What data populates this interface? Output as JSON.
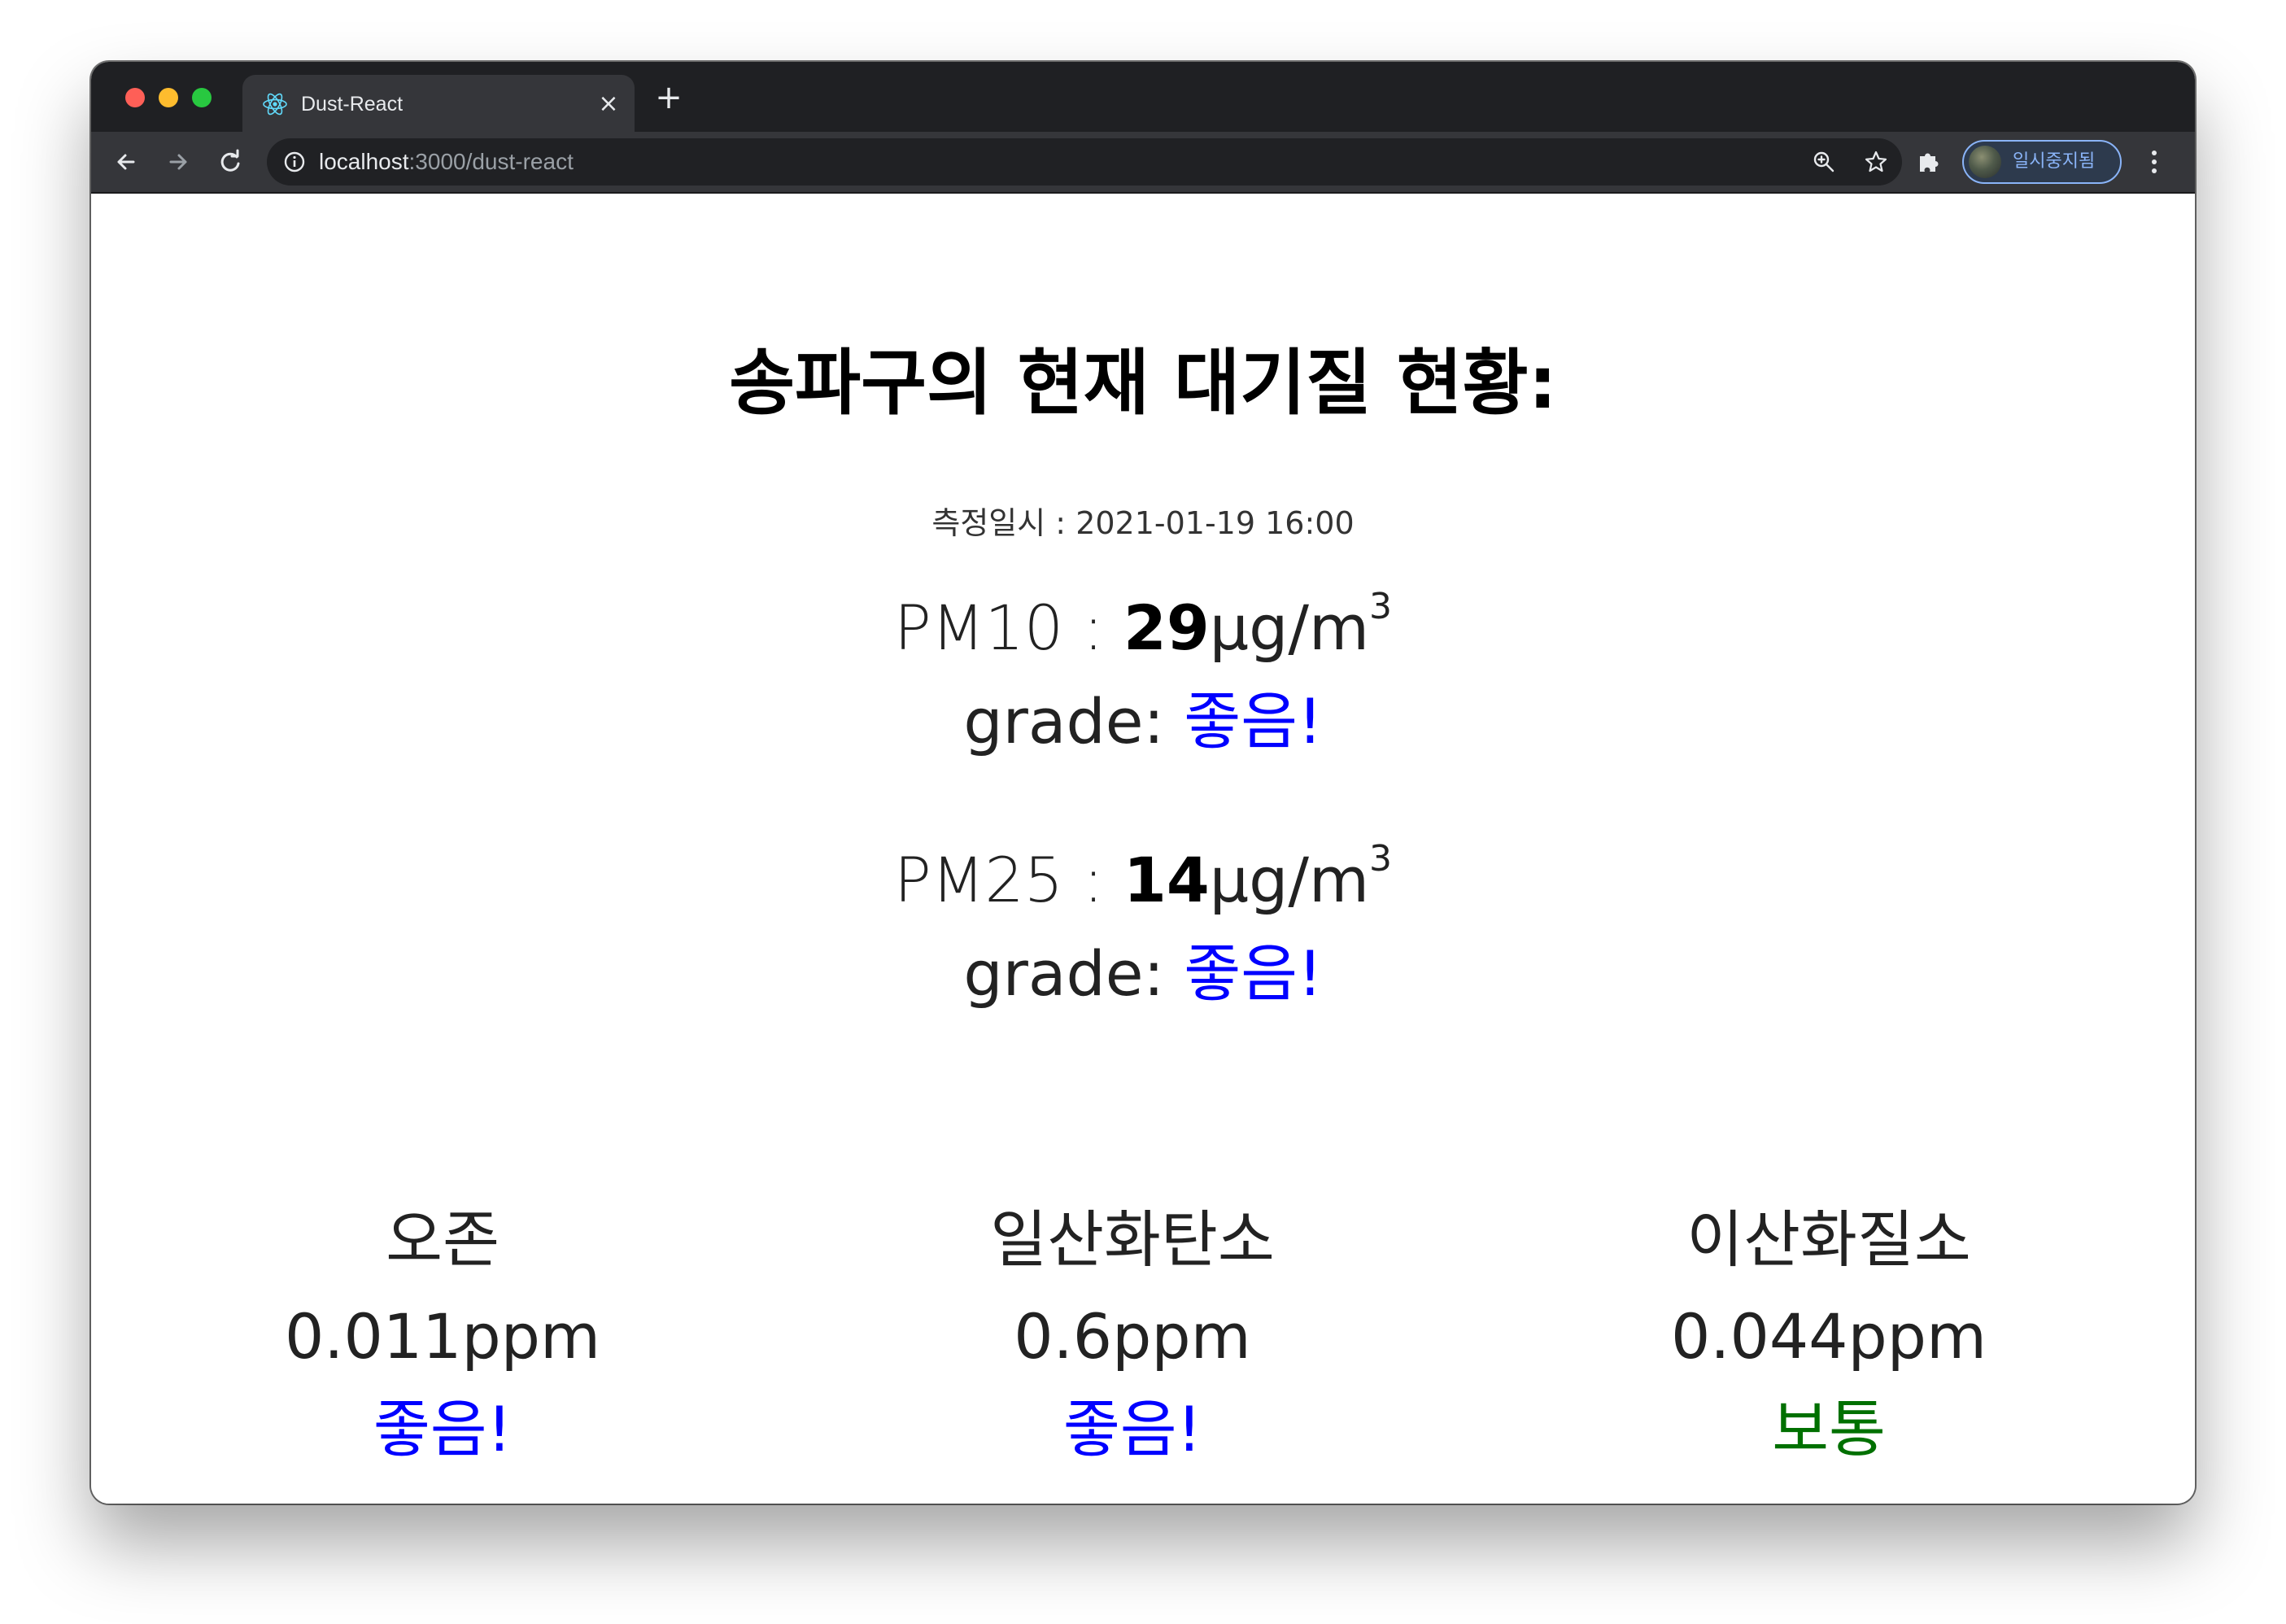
{
  "browser": {
    "tab_title": "Dust-React",
    "tab_close": "×",
    "new_tab": "+",
    "url_host": "localhost",
    "url_rest": ":3000/dust-react",
    "profile_label": "일시중지됨"
  },
  "page": {
    "title": "송파구의 현재 대기질 현황:",
    "measured_label": "측정일시 :",
    "measured_time": "2021-01-19 16:00",
    "pm10": {
      "label": "PM10",
      "separator": " : ",
      "value": "29",
      "unit": "μg/m",
      "unit_exp": "3",
      "grade_label": "grade: ",
      "grade": "좋음!"
    },
    "pm25": {
      "label": "PM25",
      "separator": " : ",
      "value": "14",
      "unit": "μg/m",
      "unit_exp": "3",
      "grade_label": "grade: ",
      "grade": "좋음!"
    },
    "gases": [
      {
        "name": "오존",
        "value": "0.011ppm",
        "grade": "좋음!"
      },
      {
        "name": "일산화탄소",
        "value": "0.6ppm",
        "grade": "좋음!"
      },
      {
        "name": "이산화질소",
        "value": "0.044ppm",
        "grade": "보통"
      }
    ]
  },
  "colors": {
    "grade_good": "#0000ff",
    "grade_normal": "#007000",
    "chrome_dark": "#1f2023",
    "chrome_toolbar": "#35363a",
    "profile_accent": "#8ab4f8"
  }
}
